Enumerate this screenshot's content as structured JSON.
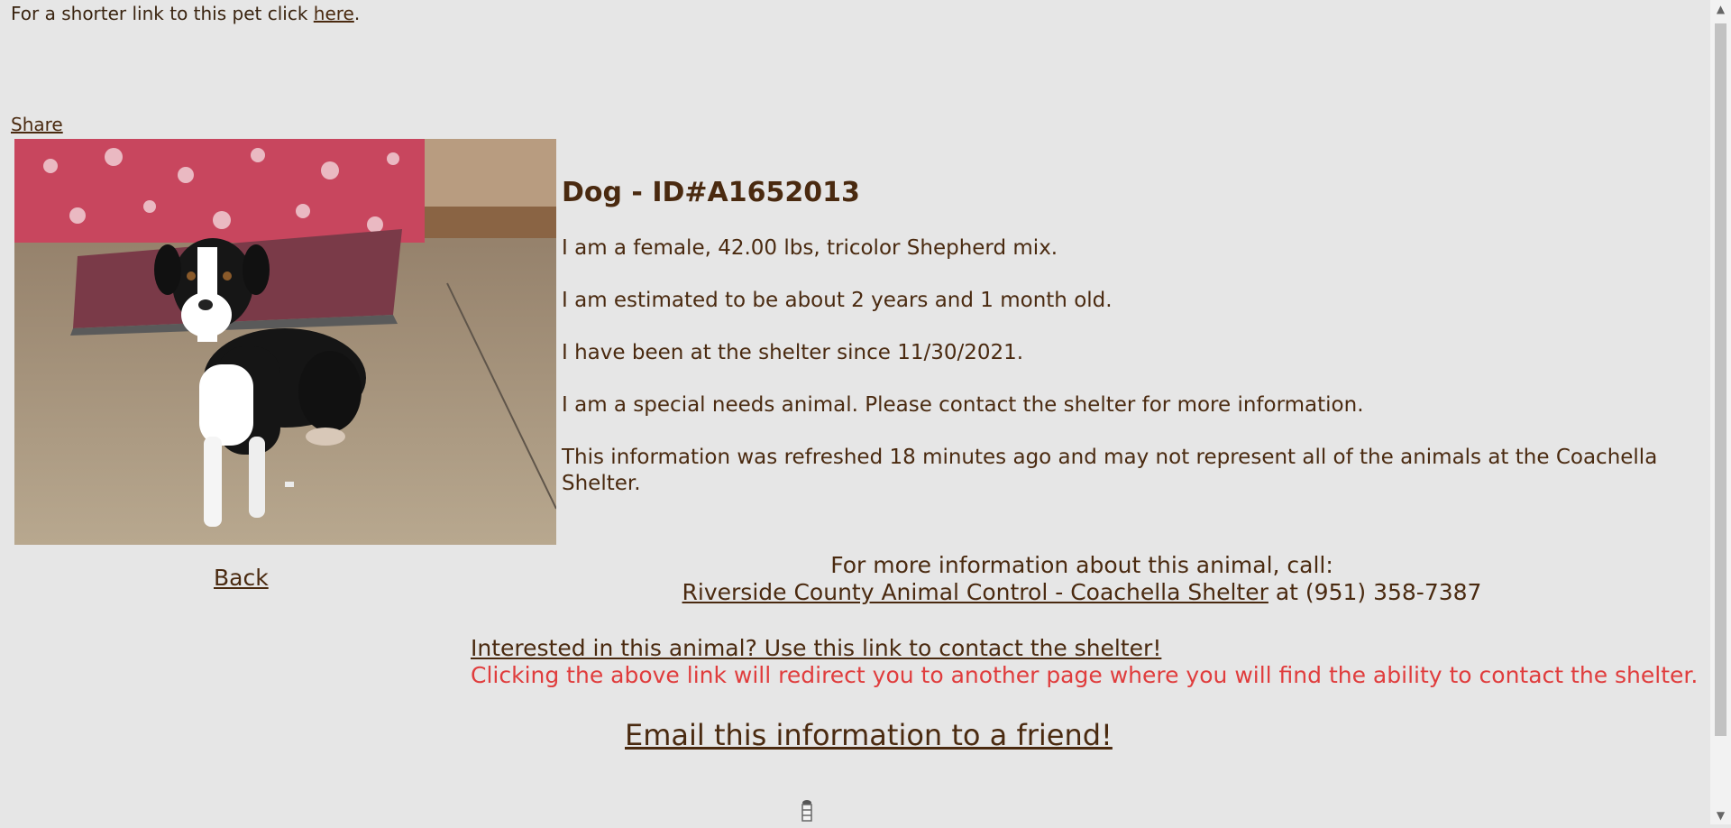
{
  "top": {
    "note_prefix": "For a shorter link to this pet click ",
    "here_link": "here",
    "note_suffix": "."
  },
  "share_label": "Share",
  "animal": {
    "title": "Dog - ID#A1652013",
    "lines": [
      "I am a female, 42.00 lbs, tricolor Shepherd mix.",
      "I am estimated to be about 2 years and 1 month old.",
      "I have been at the shelter since 11/30/2021.",
      "I am a special needs animal. Please contact the shelter for more information.",
      "This information was refreshed 18 minutes ago and may not represent all of the animals at the Coachella Shelter."
    ]
  },
  "back_label": "Back",
  "contact": {
    "call_text": "For more information about this animal, call:",
    "shelter_link": "Riverside County Animal Control - Coachella Shelter",
    "phone_text": " at (951) 358-7387"
  },
  "interest": {
    "link": "Interested in this animal? Use this link to contact the shelter!",
    "note": "Clicking the above link will redirect you to another page where you will find the ability to contact the shelter."
  },
  "email_label": "Email this information to a friend!",
  "colors": {
    "background": "#e6e6e6",
    "text": "#4a2a10",
    "warning": "#e03d3d"
  }
}
